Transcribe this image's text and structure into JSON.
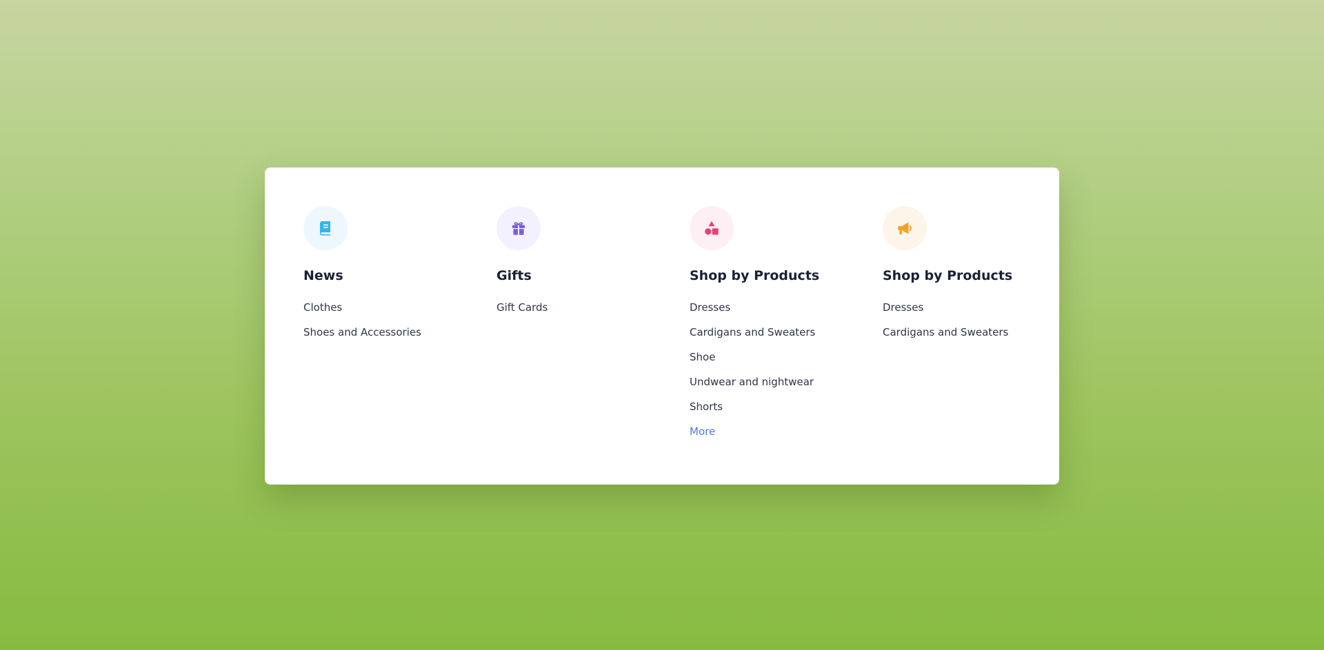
{
  "colors": {
    "card_background": "#ffffff",
    "heading": "#1b2036",
    "link": "#2f3547",
    "more_link": "#4a79e0",
    "news_icon": "#32b4f0",
    "news_icon_bg": "#eef7fd",
    "gifts_icon": "#7a5fe0",
    "gifts_icon_bg": "#f3f1fd",
    "products_icon": "#e8407a",
    "products_icon_bg": "#fdeff3",
    "promo_icon": "#f3a024",
    "promo_icon_bg": "#fef5ea"
  },
  "columns": [
    {
      "icon": "book-icon",
      "title": "News",
      "links": [
        "Clothes",
        "Shoes and Accessories"
      ]
    },
    {
      "icon": "gift-icon",
      "title": "Gifts",
      "links": [
        "Gift Cards"
      ]
    },
    {
      "icon": "shapes-icon",
      "title": "Shop by Products",
      "links": [
        "Dresses",
        "Cardigans and Sweaters",
        "Shoe",
        "Undwear and nightwear",
        "Shorts"
      ],
      "more_label": "More"
    },
    {
      "icon": "megaphone-icon",
      "title": "Shop by Products",
      "links": [
        "Dresses",
        "Cardigans and Sweaters"
      ]
    }
  ]
}
